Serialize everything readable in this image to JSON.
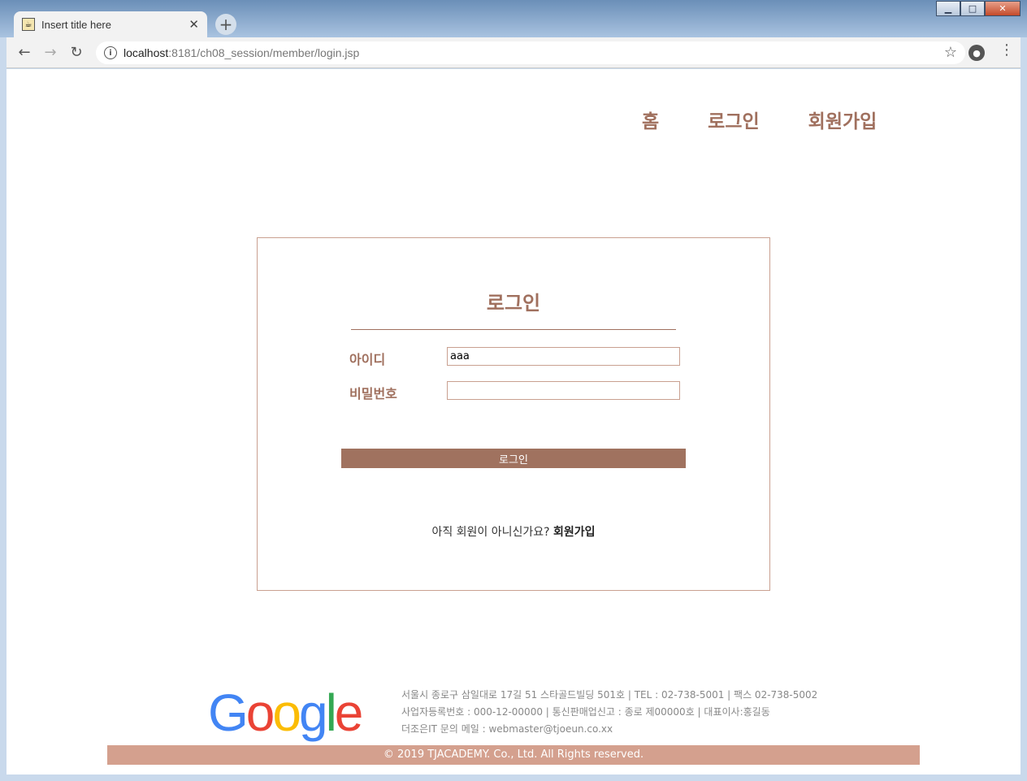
{
  "browser": {
    "tab_title": "Insert title here",
    "url_host": "localhost",
    "url_path": ":8181/ch08_session/member/login.jsp"
  },
  "nav": {
    "items": [
      "홈",
      "로그인",
      "회원가입"
    ]
  },
  "login": {
    "title": "로그인",
    "id_label": "아이디",
    "id_value": "aaa",
    "pw_label": "비밀번호",
    "pw_value": "",
    "button_label": "로그인",
    "join_prompt": "아직 회원이 아니신가요?",
    "join_link": "회원가입"
  },
  "footer": {
    "logo": "Google",
    "line1": "서울시 종로구 삼일대로 17길 51 스타골드빌딩 501호 | TEL : 02-738-5001 | 팩스 02-738-5002",
    "line2": "사업자등록번호 : 000-12-00000 | 통신판매업신고 : 종로 제00000호 | 대표이사:홍길동",
    "line3": "더조은IT 문의 메일 : webmaster@tjoeun.co.xx",
    "copyright": "© 2019 TJACADEMY. Co., Ltd. All Rights reserved."
  }
}
